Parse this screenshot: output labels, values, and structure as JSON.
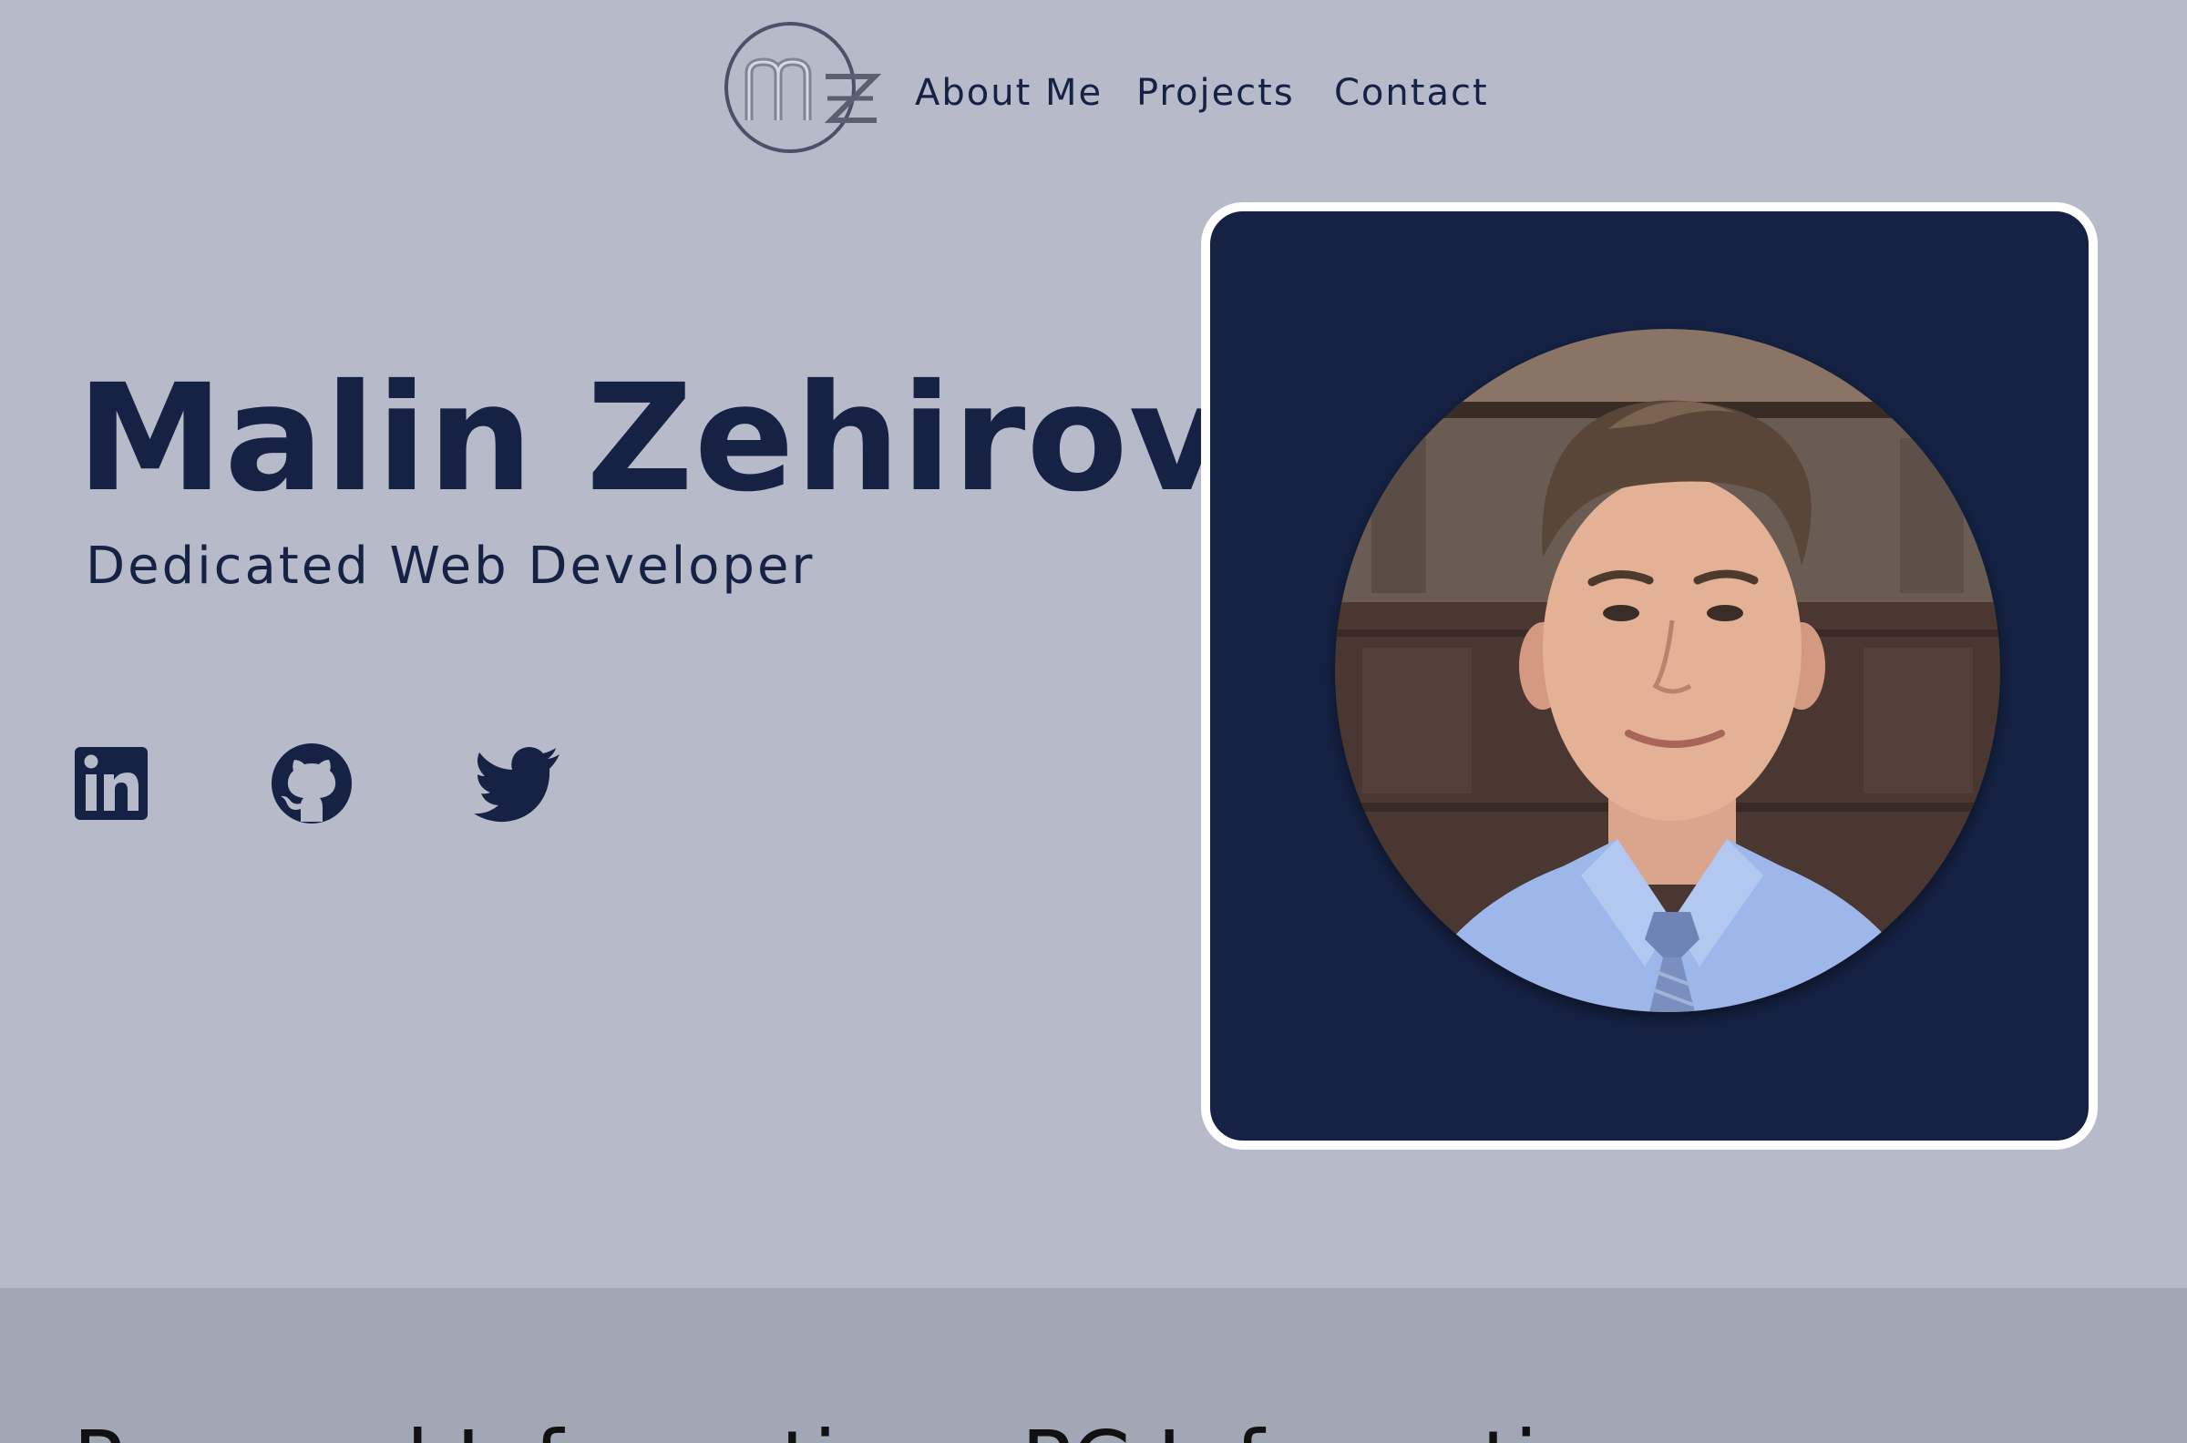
{
  "nav": {
    "logo_label": "MZ logo",
    "links": [
      {
        "label": "About Me"
      },
      {
        "label": "Projects"
      },
      {
        "label": "Contact"
      }
    ]
  },
  "hero": {
    "name": "Malin Zehirov",
    "tagline": "Dedicated Web Developer",
    "photo_alt": "Portrait of Malin Zehirov"
  },
  "social": [
    {
      "icon": "linkedin-icon",
      "label": "LinkedIn"
    },
    {
      "icon": "github-icon",
      "label": "GitHub"
    },
    {
      "icon": "twitter-icon",
      "label": "Twitter"
    }
  ],
  "bottom_section": {
    "heading": "Personal Information   ·   PC Information"
  },
  "colors": {
    "page_background": "#b7bac9",
    "navy": "#152244",
    "card_border": "#ffffff",
    "bottom_band": "#a2a7b5"
  }
}
